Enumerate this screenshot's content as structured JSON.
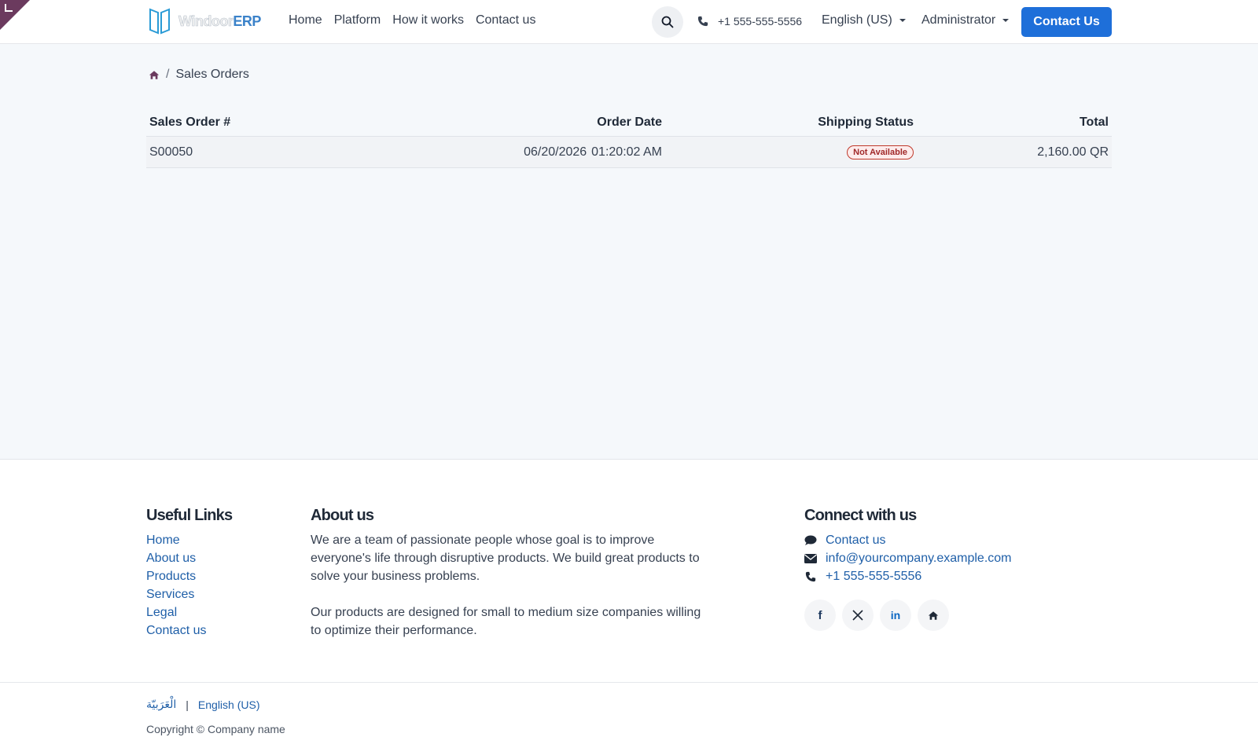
{
  "brand": {
    "name_light": "Windoor",
    "name_bold": "ERP"
  },
  "nav": {
    "items": [
      "Home",
      "Platform",
      "How it works",
      "Contact us"
    ]
  },
  "header": {
    "phone": "+1 555-555-5556",
    "language": "English (US)",
    "user": "Administrator",
    "cta": "Contact Us"
  },
  "breadcrumb": {
    "separator": "/",
    "current": "Sales Orders"
  },
  "orders": {
    "headers": [
      "Sales Order #",
      "Order Date",
      "Shipping Status",
      "Total"
    ],
    "rows": [
      {
        "number": "S00050",
        "date": "06/20/2026",
        "time": "01:20:02 AM",
        "status": "Not Available",
        "total": "2,160.00 QR"
      }
    ]
  },
  "footer": {
    "useful_links": {
      "title": "Useful Links",
      "links": [
        "Home",
        "About us",
        "Products",
        "Services",
        "Legal",
        "Contact us"
      ]
    },
    "about": {
      "title": "About us",
      "p1": "We are a team of passionate people whose goal is to improve everyone's life through disruptive products. We build great products to solve your business problems.",
      "p2": "Our products are designed for small to medium size companies willing to optimize their performance."
    },
    "connect": {
      "title": "Connect with us",
      "contact": "Contact us",
      "email": "info@yourcompany.example.com",
      "phone": "+1 555-555-5556",
      "socials": [
        "facebook-icon",
        "x-icon",
        "linkedin-icon",
        "home-icon"
      ]
    },
    "languages": [
      "الْعَرَبيّة",
      "English (US)"
    ],
    "copyright": "Copyright © Company name"
  },
  "colors": {
    "primary": "#1e6fd9",
    "link": "#1f5fa8",
    "badge_danger": "#c0392b",
    "corner": "#6b3a5e"
  }
}
